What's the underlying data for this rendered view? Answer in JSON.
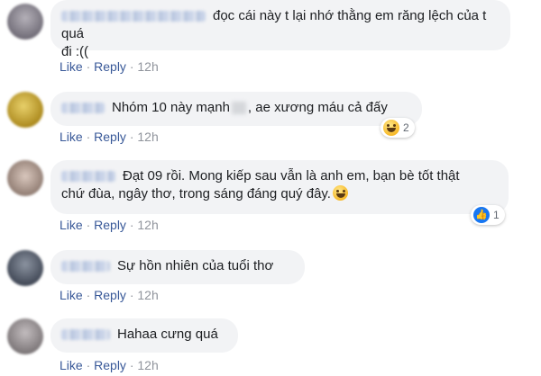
{
  "comments": [
    {
      "text": "đọc cái này t lại nhớ thằng em răng lệch của t quá đi :((",
      "line1": "đọc cái này t lại nhớ thằng em răng lệch của t quá",
      "line2": "đi :((",
      "like": "Like",
      "reply": "Reply",
      "sep": "·",
      "time": "12h",
      "avatar_color": "#8a8792"
    },
    {
      "text_a": "Nhóm 10 này mạnh",
      "text_b": ", ae xương máu cả đấy",
      "like": "Like",
      "reply": "Reply",
      "sep": "·",
      "time": "12h",
      "reaction_icon": "laughing-emoji-icon",
      "reaction_count": "2",
      "avatar_color": "#c9a52a"
    },
    {
      "line1": "Đạt 09 rồi. Mong kiếp sau vẫn là anh em, bạn bè tốt thật",
      "line2": "chứ đùa, ngây thơ, trong sáng đáng quý đây.",
      "inline_emoji": "grinning-sweat-emoji-icon",
      "like": "Like",
      "reply": "Reply",
      "sep": "·",
      "time": "12h",
      "reaction_icon": "like-icon",
      "reaction_count": "1",
      "avatar_color": "#b59a8e"
    },
    {
      "text": "Sự hồn nhiên của tuổi thơ",
      "like": "Like",
      "reply": "Reply",
      "sep": "·",
      "time": "12h",
      "avatar_color": "#5d6572"
    },
    {
      "text": "Hahaa cưng quá",
      "like": "Like",
      "reply": "Reply",
      "sep": "·",
      "time": "12h",
      "avatar_color": "#9a9496"
    }
  ]
}
